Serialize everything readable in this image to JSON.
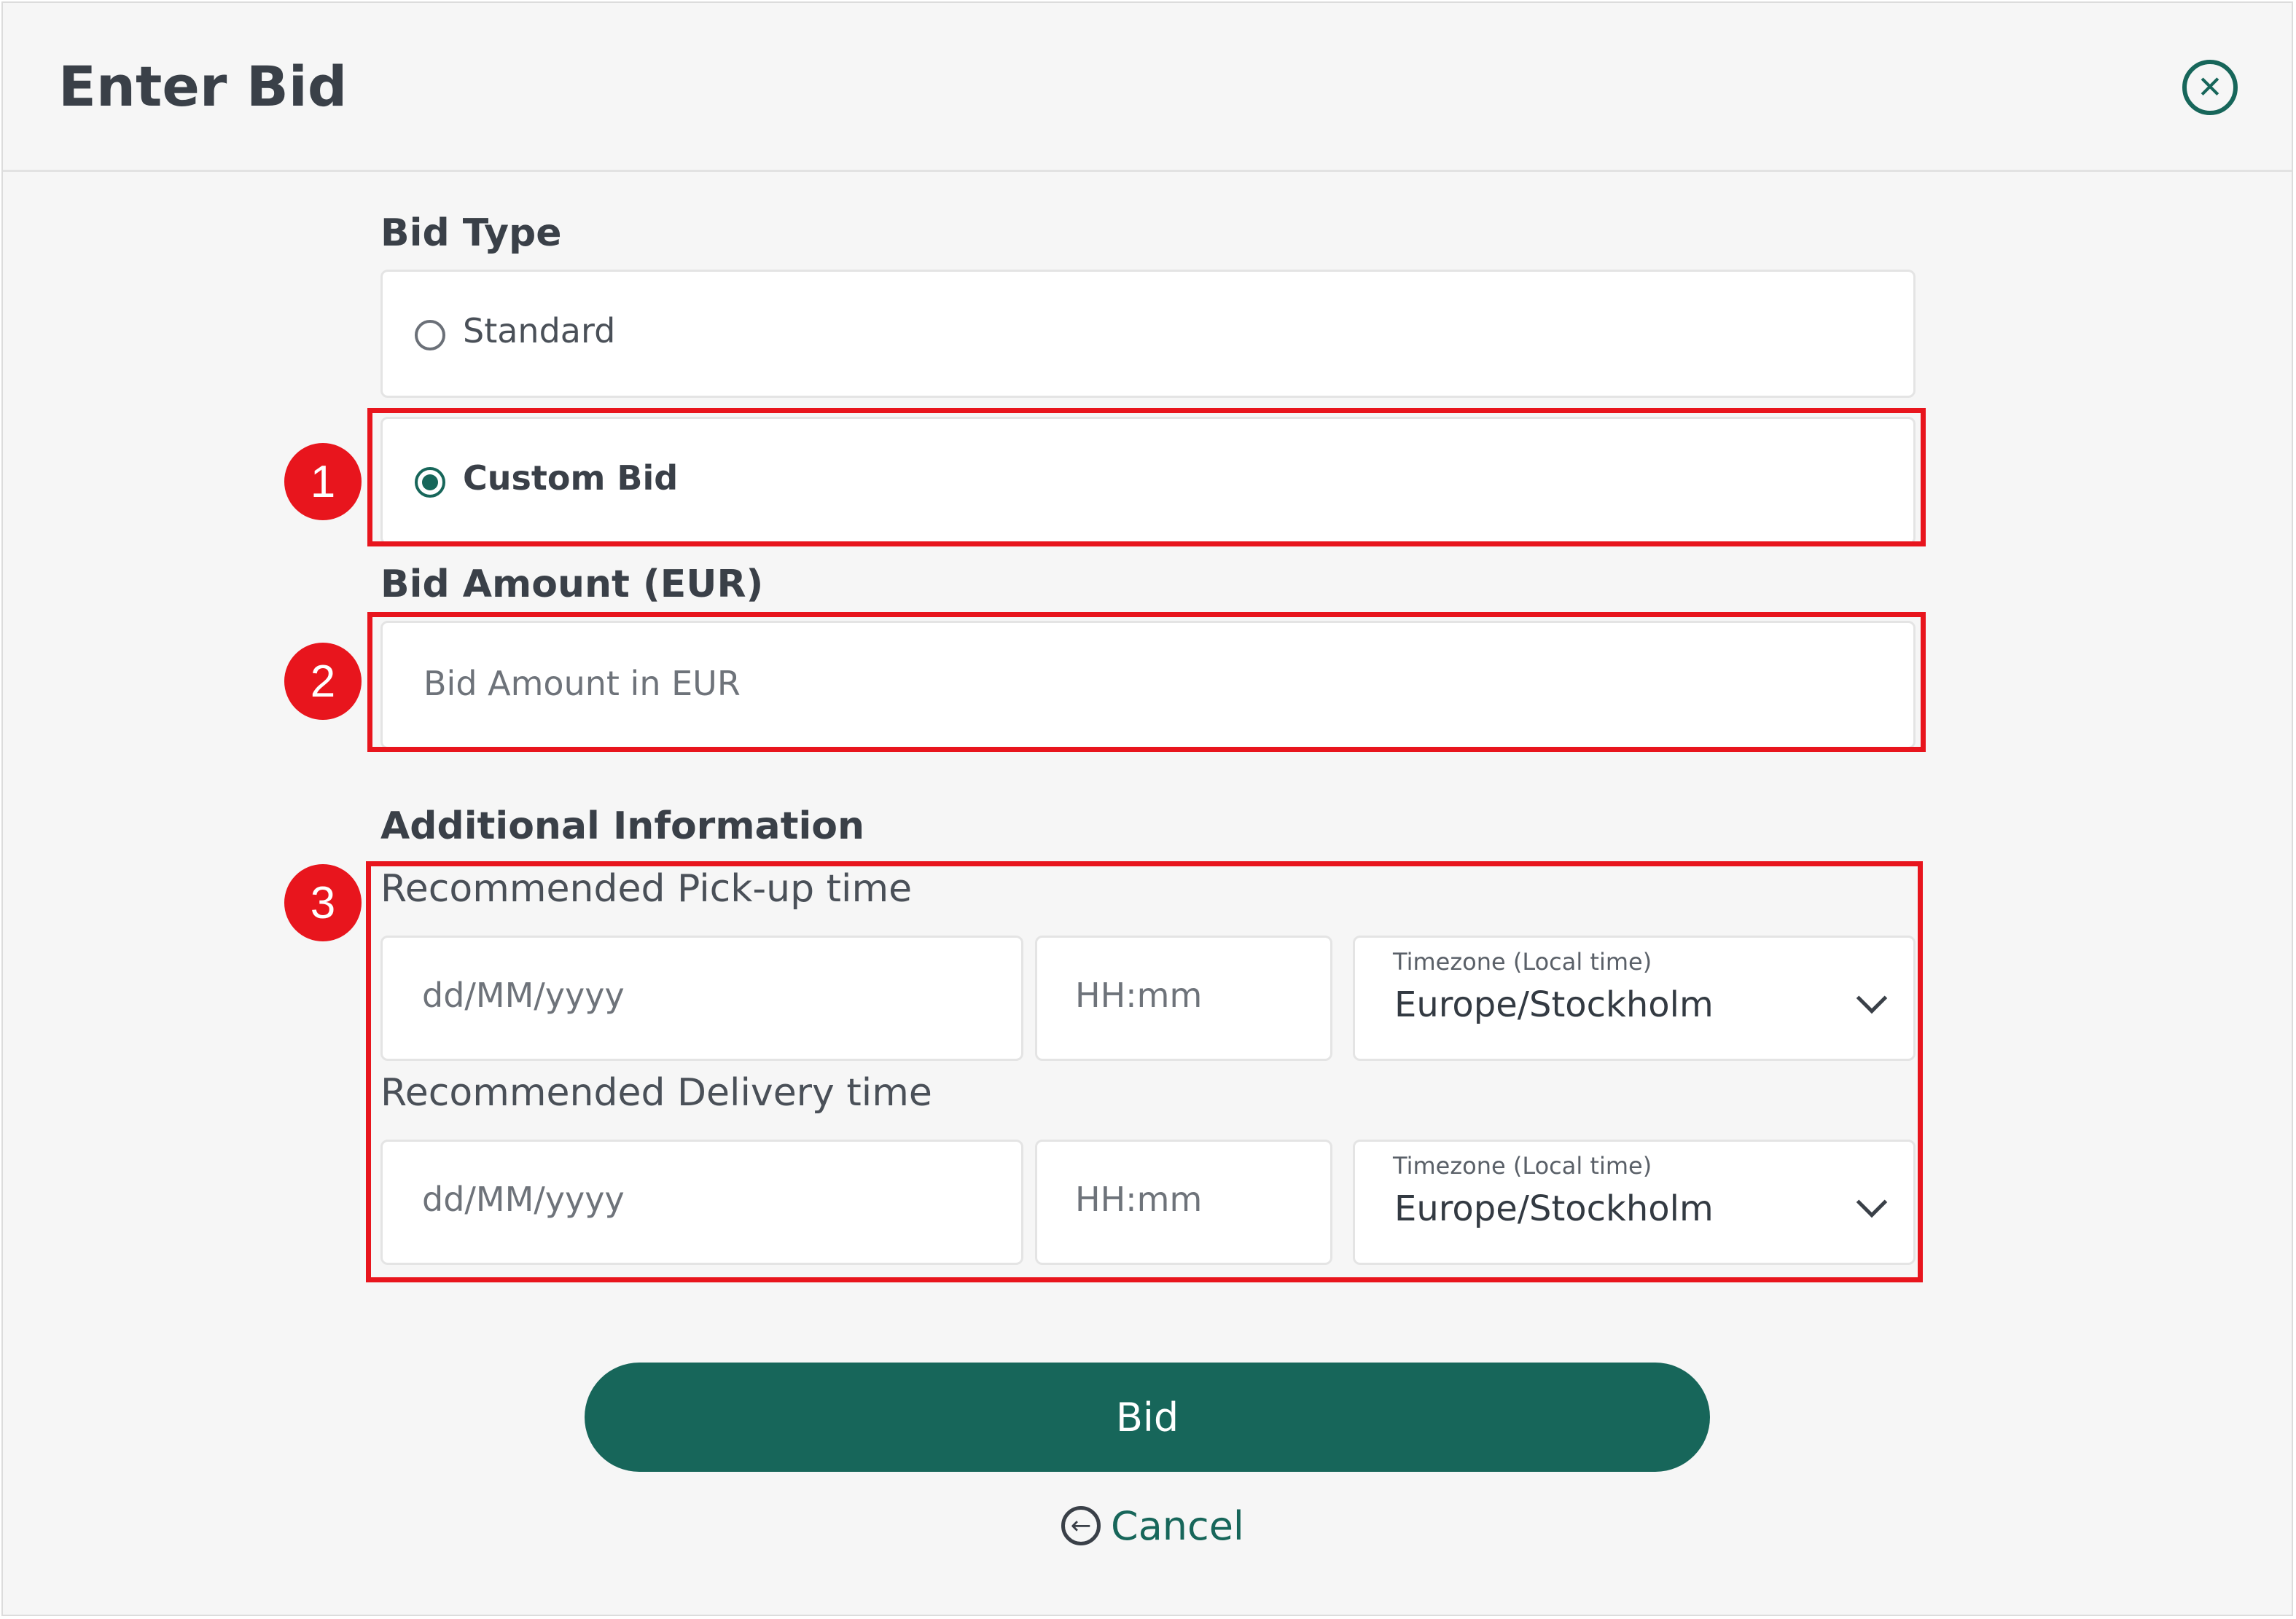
{
  "dialog": {
    "title": "Enter Bid",
    "close_icon": "close-circle-icon"
  },
  "bid_type": {
    "label": "Bid Type",
    "options": [
      {
        "label": "Standard",
        "selected": false
      },
      {
        "label": "Custom Bid",
        "selected": true
      }
    ]
  },
  "bid_amount": {
    "label": "Bid Amount (EUR)",
    "placeholder": "Bid Amount in EUR",
    "value": ""
  },
  "additional_info": {
    "label": "Additional Information",
    "pickup": {
      "label": "Recommended Pick-up time",
      "date_placeholder": "dd/MM/yyyy",
      "time_placeholder": "HH:mm",
      "timezone_caption": "Timezone (Local time)",
      "timezone_value": "Europe/Stockholm"
    },
    "delivery": {
      "label": "Recommended Delivery time",
      "date_placeholder": "dd/MM/yyyy",
      "time_placeholder": "HH:mm",
      "timezone_caption": "Timezone (Local time)",
      "timezone_value": "Europe/Stockholm"
    }
  },
  "actions": {
    "bid_label": "Bid",
    "cancel_label": "Cancel",
    "cancel_icon": "arrow-left-circle-icon"
  },
  "annotations": {
    "markers": [
      "1",
      "2",
      "3"
    ],
    "highlight_color": "#e8151d"
  },
  "colors": {
    "accent": "#17665a",
    "background": "#f6f6f6"
  }
}
